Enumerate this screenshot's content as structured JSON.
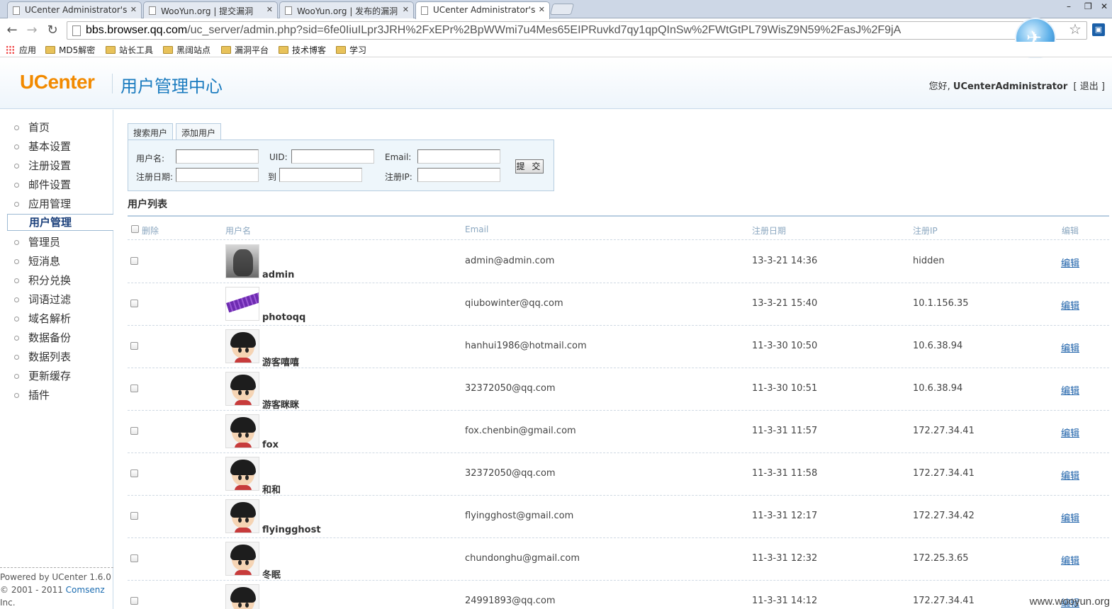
{
  "browser": {
    "tabs": [
      {
        "title": "UCenter Administrator's"
      },
      {
        "title": "WooYun.org | 提交漏洞"
      },
      {
        "title": "WooYun.org | 发布的漏洞"
      },
      {
        "title": "UCenter Administrator's"
      }
    ],
    "url_host": "bbs.browser.qq.com",
    "url_path": "/uc_server/admin.php?sid=6fe0IiuILpr3JRH%2FxEPr%2BpWWmi7u4Mes65EIPRuvkd7qy1qpQInSw%2FWtGtPL79WisZ9N59%2FasJ%2F9jA",
    "bookmarks": [
      "应用",
      "MD5解密",
      "站长工具",
      "黑阔站点",
      "漏洞平台",
      "技术博客",
      "学习"
    ]
  },
  "header": {
    "logo": "UCenter",
    "title": "用户管理中心",
    "greeting": "您好, ",
    "username": "UCenterAdministrator",
    "logout_open": "[",
    "logout": "退出",
    "logout_close": "]"
  },
  "sidebar": {
    "items": [
      {
        "label": "首页"
      },
      {
        "label": "基本设置"
      },
      {
        "label": "注册设置"
      },
      {
        "label": "邮件设置"
      },
      {
        "label": "应用管理"
      },
      {
        "label": "用户管理"
      },
      {
        "label": "管理员"
      },
      {
        "label": "短消息"
      },
      {
        "label": "积分兑换"
      },
      {
        "label": "词语过滤"
      },
      {
        "label": "域名解析"
      },
      {
        "label": "数据备份"
      },
      {
        "label": "数据列表"
      },
      {
        "label": "更新缓存"
      },
      {
        "label": "插件"
      }
    ],
    "footer_powered": "Powered by UCenter 1.6.0",
    "footer_copy": "© 2001 - 2011 ",
    "footer_company": "Comsenz",
    "footer_inc": "Inc."
  },
  "search": {
    "tab_search": "搜索用户",
    "tab_add": "添加用户",
    "label_username": "用户名:",
    "label_uid": "UID:",
    "label_email": "Email:",
    "label_regdate": "注册日期:",
    "label_to": "到",
    "label_regip": "注册IP:",
    "submit": "提 交"
  },
  "list": {
    "title": "用户列表",
    "headers": {
      "delete": "删除",
      "username": "用户名",
      "email": "Email",
      "regdate": "注册日期",
      "regip": "注册IP",
      "edit": "编辑"
    },
    "edit_label": "编辑",
    "rows": [
      {
        "username": "admin",
        "email": "admin@admin.com",
        "regdate": "13-3-21 14:36",
        "regip": "hidden",
        "avatar": "admin-photo"
      },
      {
        "username": "photoqq",
        "email": "qiubowinter@qq.com",
        "regdate": "13-3-21 15:40",
        "regip": "10.1.156.35",
        "avatar": "purple-photo"
      },
      {
        "username": "游客嘻嘻",
        "email": "hanhui1986@hotmail.com",
        "regdate": "11-3-30 10:50",
        "regip": "10.6.38.94",
        "avatar": "default-kid"
      },
      {
        "username": "游客眯眯",
        "email": "32372050@qq.com",
        "regdate": "11-3-30 10:51",
        "regip": "10.6.38.94",
        "avatar": "default-kid"
      },
      {
        "username": "fox",
        "email": "fox.chenbin@gmail.com",
        "regdate": "11-3-31 11:57",
        "regip": "172.27.34.41",
        "avatar": "default-kid"
      },
      {
        "username": "和和",
        "email": "32372050@qq.com",
        "regdate": "11-3-31 11:58",
        "regip": "172.27.34.41",
        "avatar": "default-kid"
      },
      {
        "username": "flyingghost",
        "email": "flyingghost@gmail.com",
        "regdate": "11-3-31 12:17",
        "regip": "172.27.34.42",
        "avatar": "default-kid"
      },
      {
        "username": "冬眠",
        "email": "chundonghu@gmail.com",
        "regdate": "11-3-31 12:32",
        "regip": "172.25.3.65",
        "avatar": "default-kid"
      },
      {
        "username": "",
        "email": "24991893@qq.com",
        "regdate": "11-3-31 14:12",
        "regip": "172.27.34.41",
        "avatar": "default-kid"
      }
    ]
  },
  "watermark": "www.wooyun.org"
}
